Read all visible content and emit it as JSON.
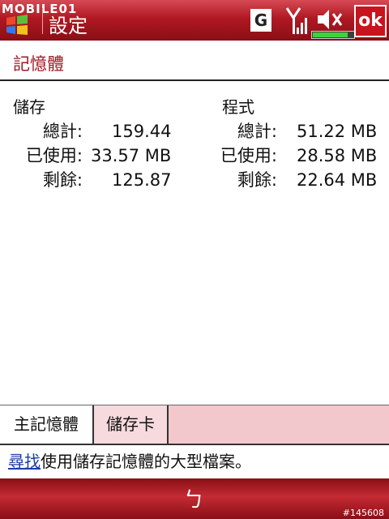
{
  "watermark": "MOBILE01",
  "titlebar": {
    "title": "設定",
    "ok_label": "ok",
    "g_label": "G"
  },
  "battery": {
    "level": 0.85
  },
  "page": {
    "heading": "記憶體"
  },
  "storage": {
    "title": "儲存",
    "rows": [
      {
        "label": "總計:",
        "value": "159.44"
      },
      {
        "label": "已使用:",
        "value": "33.57 MB"
      },
      {
        "label": "剩餘:",
        "value": "125.87"
      }
    ]
  },
  "program": {
    "title": "程式",
    "rows": [
      {
        "label": "總計:",
        "value": "51.22 MB"
      },
      {
        "label": "已使用:",
        "value": "28.58 MB"
      },
      {
        "label": "剩餘:",
        "value": "22.64 MB"
      }
    ]
  },
  "tabs": [
    {
      "label": "主記憶體"
    },
    {
      "label": "儲存卡"
    }
  ],
  "footer": {
    "link": "尋找",
    "text": "使用儲存記憶體的大型檔案。"
  },
  "bottom": {
    "keyboard_glyph": "ㄅ",
    "image_id": "#145608"
  },
  "colors": {
    "title_red": "#b01822",
    "heading_red": "#9c1a24",
    "tab_bar": "#f2c8cd",
    "link_blue": "#1a3fa8"
  }
}
